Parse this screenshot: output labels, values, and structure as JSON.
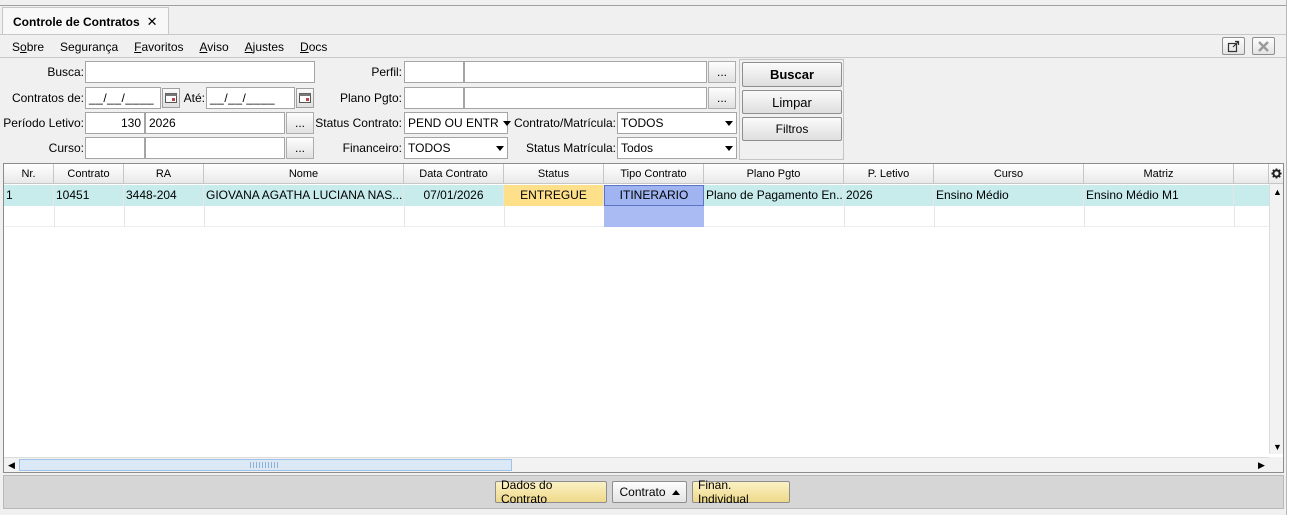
{
  "tab": {
    "title": "Controle de Contratos",
    "close": "✕"
  },
  "menu": [
    {
      "pre": "S",
      "u": "o",
      "post": "bre"
    },
    {
      "pre": "Se",
      "u": "g",
      "post": "urança"
    },
    {
      "pre": "",
      "u": "F",
      "post": "avoritos"
    },
    {
      "pre": "",
      "u": "A",
      "post": "viso"
    },
    {
      "pre": "",
      "u": "A",
      "post": "justes"
    },
    {
      "pre": "",
      "u": "D",
      "post": "ocs"
    }
  ],
  "form": {
    "busca_label": "Busca:",
    "busca_value": "",
    "contratos_de_label": "Contratos de:",
    "contratos_de_value": "__/__/____",
    "ate_label": "Até:",
    "ate_value": "__/__/____",
    "periodo_label": "Período Letivo:",
    "periodo_code": "130",
    "periodo_year": "2026",
    "curso_label": "Curso:",
    "perfil_label": "Perfil:",
    "plano_label": "Plano Pgto:",
    "status_contrato_label": "Status Contrato:",
    "status_contrato_value": "PEND OU ENTR",
    "financeiro_label": "Financeiro:",
    "financeiro_value": "TODOS",
    "contrato_matricula_label": "Contrato/Matrícula:",
    "contrato_matricula_value": "TODOS",
    "status_matricula_label": "Status Matrícula:",
    "status_matricula_value": "Todos",
    "dots": "..."
  },
  "buttons": {
    "buscar": "Buscar",
    "limpar": "Limpar",
    "filtros": "Filtros"
  },
  "grid": {
    "columns": [
      "Nr.",
      "Contrato",
      "RA",
      "Nome",
      "Data Contrato",
      "Status",
      "Tipo Contrato",
      "Plano Pgto",
      "P. Letivo",
      "Curso",
      "Matriz"
    ],
    "rows": [
      {
        "nr": "1",
        "contrato": "10451",
        "ra": "3448-204",
        "nome": "GIOVANA AGATHA LUCIANA NAS...",
        "data": "07/01/2026",
        "status": "ENTREGUE",
        "tipo": "ITINERARIO",
        "plano": "Plano de Pagamento En...",
        "letivo": "2026",
        "curso": "Ensino Médio",
        "matriz": "Ensino Médio M1"
      }
    ]
  },
  "bottom": {
    "dados": "Dados do Contrato",
    "contrato": "Contrato",
    "finan": "Finan. Individual"
  },
  "colors": {
    "row_selected": "#c8ecec",
    "status_bg": "#ffe08a",
    "tipo_bg": "#9fb4f0"
  }
}
